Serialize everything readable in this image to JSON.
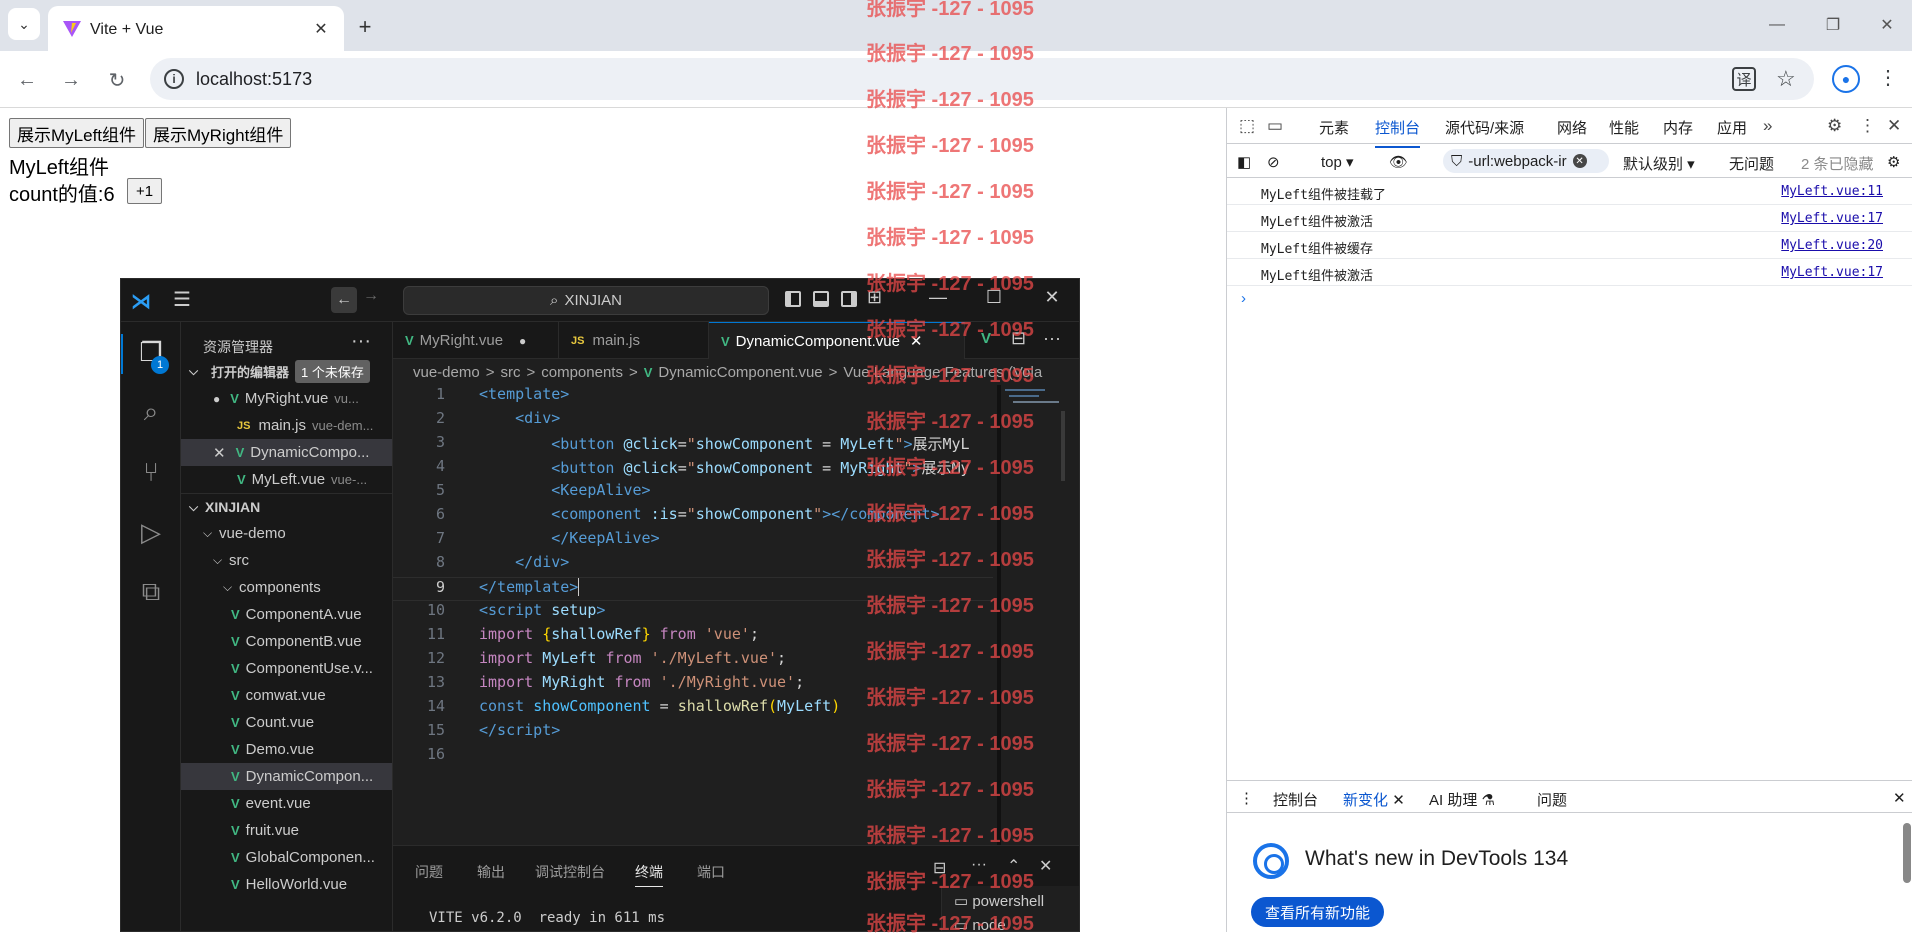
{
  "browser": {
    "tab_title": "Vite + Vue",
    "url": "localhost:5173"
  },
  "page": {
    "show_left_button": "展示MyLeft组件",
    "show_right_button": "展示MyRight组件",
    "component_title": "MyLeft组件",
    "count_label": "count的值:6",
    "increment_button": "+1"
  },
  "vscode": {
    "search_text": "XINJIAN",
    "explorer_title": "资源管理器",
    "activity_badge": "1",
    "open_editors_label": "打开的编辑器",
    "unsaved_badge": "1 个未保存",
    "open_editors": [
      {
        "name": "MyRight.vue",
        "path": "vu..."
      },
      {
        "name": "main.js",
        "path": "vue-dem..."
      },
      {
        "name": "DynamicCompo...",
        "path": ""
      },
      {
        "name": "MyLeft.vue",
        "path": "vue-..."
      }
    ],
    "folder_root": "XINJIAN",
    "tree": [
      "vue-demo",
      "src",
      "components"
    ],
    "files": [
      "ComponentA.vue",
      "ComponentB.vue",
      "ComponentUse.v...",
      "comwat.vue",
      "Count.vue",
      "Demo.vue",
      "DynamicCompon...",
      "event.vue",
      "fruit.vue",
      "GlobalComponen...",
      "HelloWorld.vue"
    ],
    "tabs": [
      "MyRight.vue",
      "main.js",
      "DynamicComponent.vue"
    ],
    "breadcrumb": [
      "vue-demo",
      ">",
      "src",
      ">",
      "components",
      ">",
      "DynamicComponent.vue",
      ">",
      "Vue Language Features (Vola"
    ],
    "line_numbers": [
      "1",
      "2",
      "3",
      "4",
      "5",
      "6",
      "7",
      "8",
      "9",
      "10",
      "11",
      "12",
      "13",
      "14",
      "15",
      "16"
    ],
    "panel_tabs": [
      "问题",
      "输出",
      "调试控制台",
      "终端",
      "端口"
    ],
    "terminal_line": "VITE v6.2.0  ready in 611 ms",
    "terminal_list": [
      "powershell",
      "node"
    ]
  },
  "devtools": {
    "tabs": [
      "元素",
      "控制台",
      "源代码/来源",
      "网络",
      "性能",
      "内存",
      "应用"
    ],
    "context": "top",
    "filter": "-url:webpack-ir",
    "levels": "默认级别",
    "issues": "无问题",
    "hidden": "2 条已隐藏",
    "logs": [
      {
        "msg": "MyLeft组件被挂载了",
        "src": "MyLeft.vue:11"
      },
      {
        "msg": "MyLeft组件被激活",
        "src": "MyLeft.vue:17"
      },
      {
        "msg": "MyLeft组件被缓存",
        "src": "MyLeft.vue:20"
      },
      {
        "msg": "MyLeft组件被激活",
        "src": "MyLeft.vue:17"
      }
    ],
    "drawer_tabs": [
      "控制台",
      "新变化",
      "AI 助理",
      "问题"
    ],
    "whatsnew_title": "What's new in DevTools 134",
    "whatsnew_button": "查看所有新功能"
  },
  "watermark": "张振宇 -127 - 1095"
}
